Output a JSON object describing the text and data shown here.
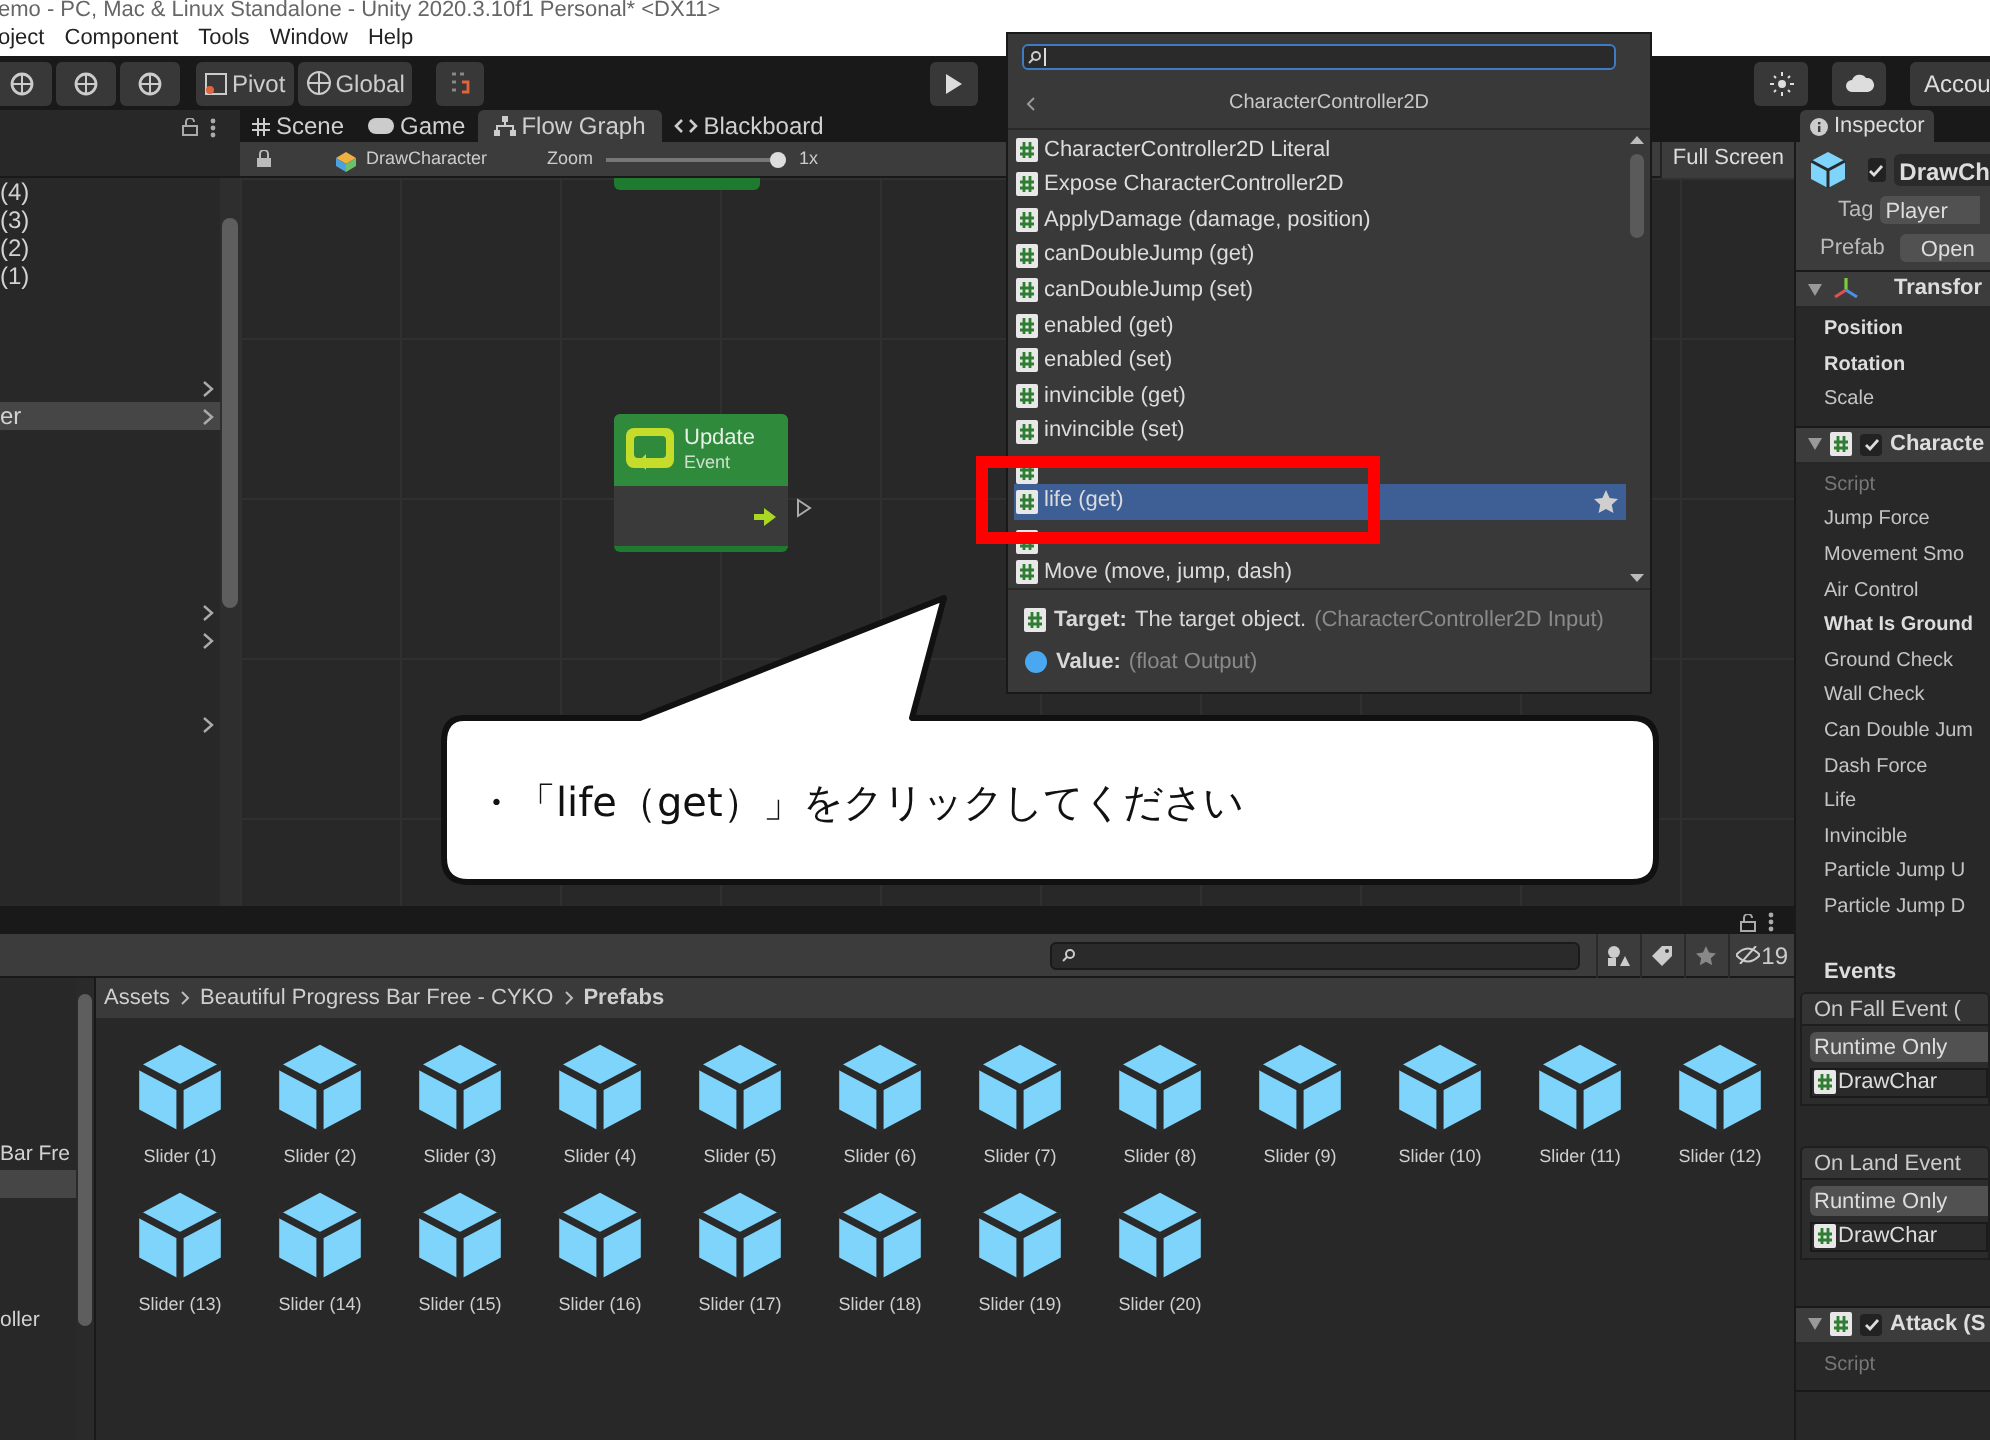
{
  "title_bar": {
    "title": "emo - PC, Mac & Linux Standalone - Unity 2020.3.10f1 Personal* <DX11>"
  },
  "menu_bar": [
    "oject",
    "Component",
    "Tools",
    "Window",
    "Help"
  ],
  "toolbar": {
    "pivot": "Pivot",
    "global": "Global",
    "account": "Accou"
  },
  "hierarchy": {
    "items": [
      {
        "label": "(4)",
        "expandable": false,
        "selected": false
      },
      {
        "label": "(3)",
        "expandable": false,
        "selected": false
      },
      {
        "label": "(2)",
        "expandable": false,
        "selected": false
      },
      {
        "label": "(1)",
        "expandable": false,
        "selected": false
      },
      {
        "expandable": true,
        "selected": false
      },
      {
        "label": "er",
        "expandable": true,
        "selected": true
      },
      {
        "expandable": true,
        "selected": false
      },
      {
        "expandable": true,
        "selected": false
      },
      {
        "expandable": true,
        "selected": false
      }
    ]
  },
  "graph_tabs": [
    {
      "label": "Scene",
      "selected": false
    },
    {
      "label": "Game",
      "selected": false
    },
    {
      "label": "Flow Graph",
      "selected": true
    },
    {
      "label": "Blackboard",
      "selected": false
    }
  ],
  "graph_toolbar": {
    "asset": "DrawCharacter",
    "zoom_label": "Zoom",
    "level": 1,
    "zoom_value": "1x",
    "fullscreen": "Full Screen"
  },
  "graph_nodes": [
    {
      "title": "Update",
      "subtitle": "Event"
    }
  ],
  "fuzzy_finder": {
    "header": "CharacterController2D",
    "items": [
      {
        "label": "CharacterController2D Literal",
        "selected": false
      },
      {
        "label": "Expose CharacterController2D",
        "selected": false
      },
      {
        "label": "ApplyDamage (damage, position)",
        "selected": false
      },
      {
        "label": "canDoubleJump (get)",
        "selected": false
      },
      {
        "label": "canDoubleJump (set)",
        "selected": false
      },
      {
        "label": "enabled (get)",
        "selected": false
      },
      {
        "label": "enabled (set)",
        "selected": false
      },
      {
        "label": "invincible (get)",
        "selected": false
      },
      {
        "label": "invincible (set)",
        "selected": false
      },
      {
        "kind": "obscured"
      },
      {
        "label": "life (get)",
        "selected": true
      },
      {
        "kind": "obscured"
      },
      {
        "label": "Move (move, jump, dash)",
        "selected": false
      }
    ],
    "ports": [
      {
        "kind": "input",
        "name": "Target:",
        "description": "The target object.",
        "type": "(CharacterController2D Input)"
      },
      {
        "kind": "output",
        "name": "Value:",
        "type": "(float Output)"
      }
    ]
  },
  "callout": {
    "text": "・「life（get）」をクリックしてください"
  },
  "project": {
    "count": "19",
    "tree": [
      {
        "label": "Bar Fre",
        "selected": false
      },
      {
        "selected": true
      },
      {
        "label": "oller",
        "selected": false
      }
    ],
    "breadcrumb": [
      "Assets",
      "Beautiful Progress Bar Free - CYKO",
      "Prefabs"
    ],
    "assets": [
      "Slider (1)",
      "Slider (2)",
      "Slider (3)",
      "Slider (4)",
      "Slider (5)",
      "Slider (6)",
      "Slider (7)",
      "Slider (8)",
      "Slider (9)",
      "Slider (10)",
      "Slider (11)",
      "Slider (12)",
      "Slider (13)",
      "Slider (14)",
      "Slider (15)",
      "Slider (16)",
      "Slider (17)",
      "Slider (18)",
      "Slider (19)",
      "Slider (20)"
    ]
  },
  "inspector": {
    "tab": "Inspector",
    "object_name": "DrawCh",
    "active": true,
    "tag_label": "Tag",
    "tag": "Player",
    "prefab_label": "Prefab",
    "prefab_button": "Open",
    "components": [
      {
        "title": "Transfor",
        "kind": "transform",
        "fields": [
          {
            "label": "Position",
            "bold": true
          },
          {
            "label": "Rotation",
            "bold": true
          },
          {
            "label": "Scale",
            "bold": false
          }
        ]
      },
      {
        "title": "Characte",
        "kind": "script",
        "enabled": true,
        "fields": [
          {
            "label": "Script",
            "disabled": true
          },
          {
            "label": "Jump Force"
          },
          {
            "label": "Movement Smo"
          },
          {
            "label": "Air Control"
          },
          {
            "label": "What Is Ground",
            "bold": true
          },
          {
            "label": "Ground Check"
          },
          {
            "label": "Wall Check"
          },
          {
            "label": "Can Double Jum"
          },
          {
            "label": "Dash Force"
          },
          {
            "label": "Life"
          },
          {
            "label": "Invincible"
          },
          {
            "label": "Particle Jump U"
          },
          {
            "label": "Particle Jump D"
          }
        ],
        "events_label": "Events",
        "events": [
          {
            "title": "On Fall Event (",
            "mode": "Runtime Only",
            "target": "DrawChar"
          },
          {
            "title": "On Land Event",
            "mode": "Runtime Only",
            "target": "DrawChar"
          }
        ]
      },
      {
        "title": "Attack (S",
        "kind": "script",
        "enabled": true,
        "fields": [
          {
            "label": "Script",
            "disabled": true
          }
        ]
      }
    ]
  }
}
